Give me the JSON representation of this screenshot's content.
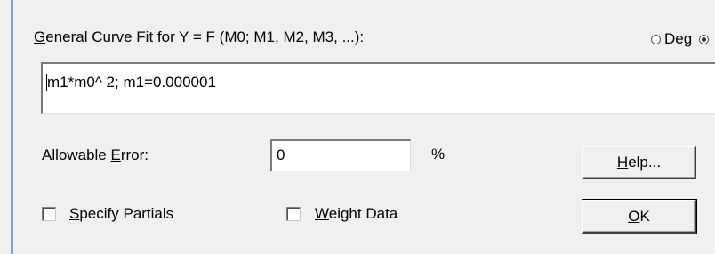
{
  "dialog": {
    "formula_label": "General Curve Fit for Y = F (M0;  M1, M2, M3, ...):",
    "formula_label_hotkey": "G",
    "formula_label_rest": "eneral Curve Fit for Y = F (M0;  M1, M2, M3, ...):",
    "angle_units": {
      "deg_label": "Deg",
      "deg_selected": false,
      "rad_selected": true
    },
    "formula_value": "m1*m0^ 2; m1=0.000001",
    "allowable_error": {
      "label_prefix": "Allowable ",
      "label_hotkey": "E",
      "label_suffix": "rror:",
      "value": "0",
      "unit": "%"
    },
    "specify_partials": {
      "hotkey": "S",
      "rest": "pecify Partials",
      "checked": false
    },
    "weight_data": {
      "hotkey": "W",
      "rest": "eight Data",
      "checked": false
    },
    "help_button": {
      "hotkey": "H",
      "rest": "elp..."
    },
    "ok_button": {
      "hotkey": "O",
      "rest": "K"
    }
  }
}
